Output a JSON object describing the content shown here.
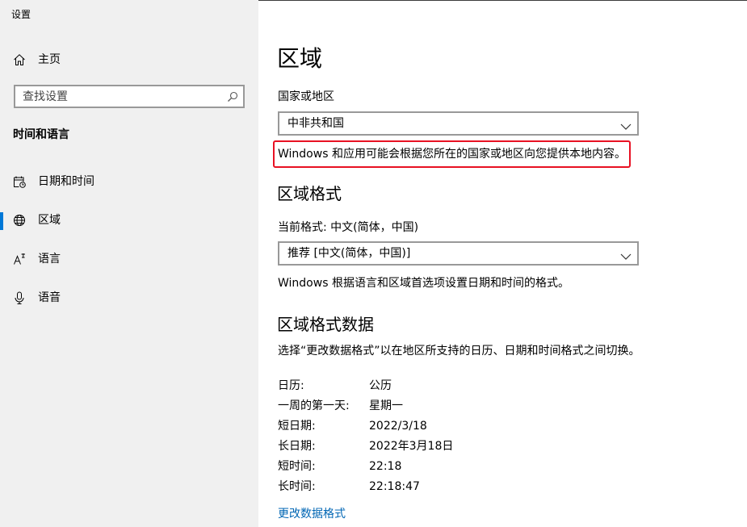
{
  "window": {
    "title": "设置"
  },
  "sidebar": {
    "home": {
      "label": "主页",
      "icon": "home-icon"
    },
    "search": {
      "placeholder": "查找设置",
      "icon": "search-icon"
    },
    "section_title": "时间和语言",
    "items": [
      {
        "label": "日期和时间",
        "icon": "date-time-icon",
        "selected": false
      },
      {
        "label": "区域",
        "icon": "region-icon",
        "selected": true
      },
      {
        "label": "语言",
        "icon": "language-icon",
        "selected": false
      },
      {
        "label": "语音",
        "icon": "speech-icon",
        "selected": false
      }
    ]
  },
  "main": {
    "title": "区域",
    "country": {
      "label": "国家或地区",
      "value": "中非共和国",
      "note": "Windows 和应用可能会根据您所在的国家或地区向您提供本地内容。"
    },
    "format": {
      "heading": "区域格式",
      "current_label": "当前格式: 中文(简体，中国)",
      "value": "推荐 [中文(简体，中国)]",
      "note": "Windows 根据语言和区域首选项设置日期和时间的格式。"
    },
    "format_data": {
      "heading": "区域格式数据",
      "description": "选择“更改数据格式”以在地区所支持的日历、日期和时间格式之间切换。",
      "rows": [
        {
          "label": "日历:",
          "value": "公历"
        },
        {
          "label": "一周的第一天:",
          "value": "星期一"
        },
        {
          "label": "短日期:",
          "value": "2022/3/18"
        },
        {
          "label": "长日期:",
          "value": "2022年3月18日"
        },
        {
          "label": "短时间:",
          "value": "22:18"
        },
        {
          "label": "长时间:",
          "value": "22:18:47"
        }
      ],
      "link": "更改数据格式"
    }
  },
  "colors": {
    "accent": "#0078d7",
    "highlight": "#e81123",
    "link": "#0066b4",
    "sidebar_bg": "#f0f0f0"
  }
}
